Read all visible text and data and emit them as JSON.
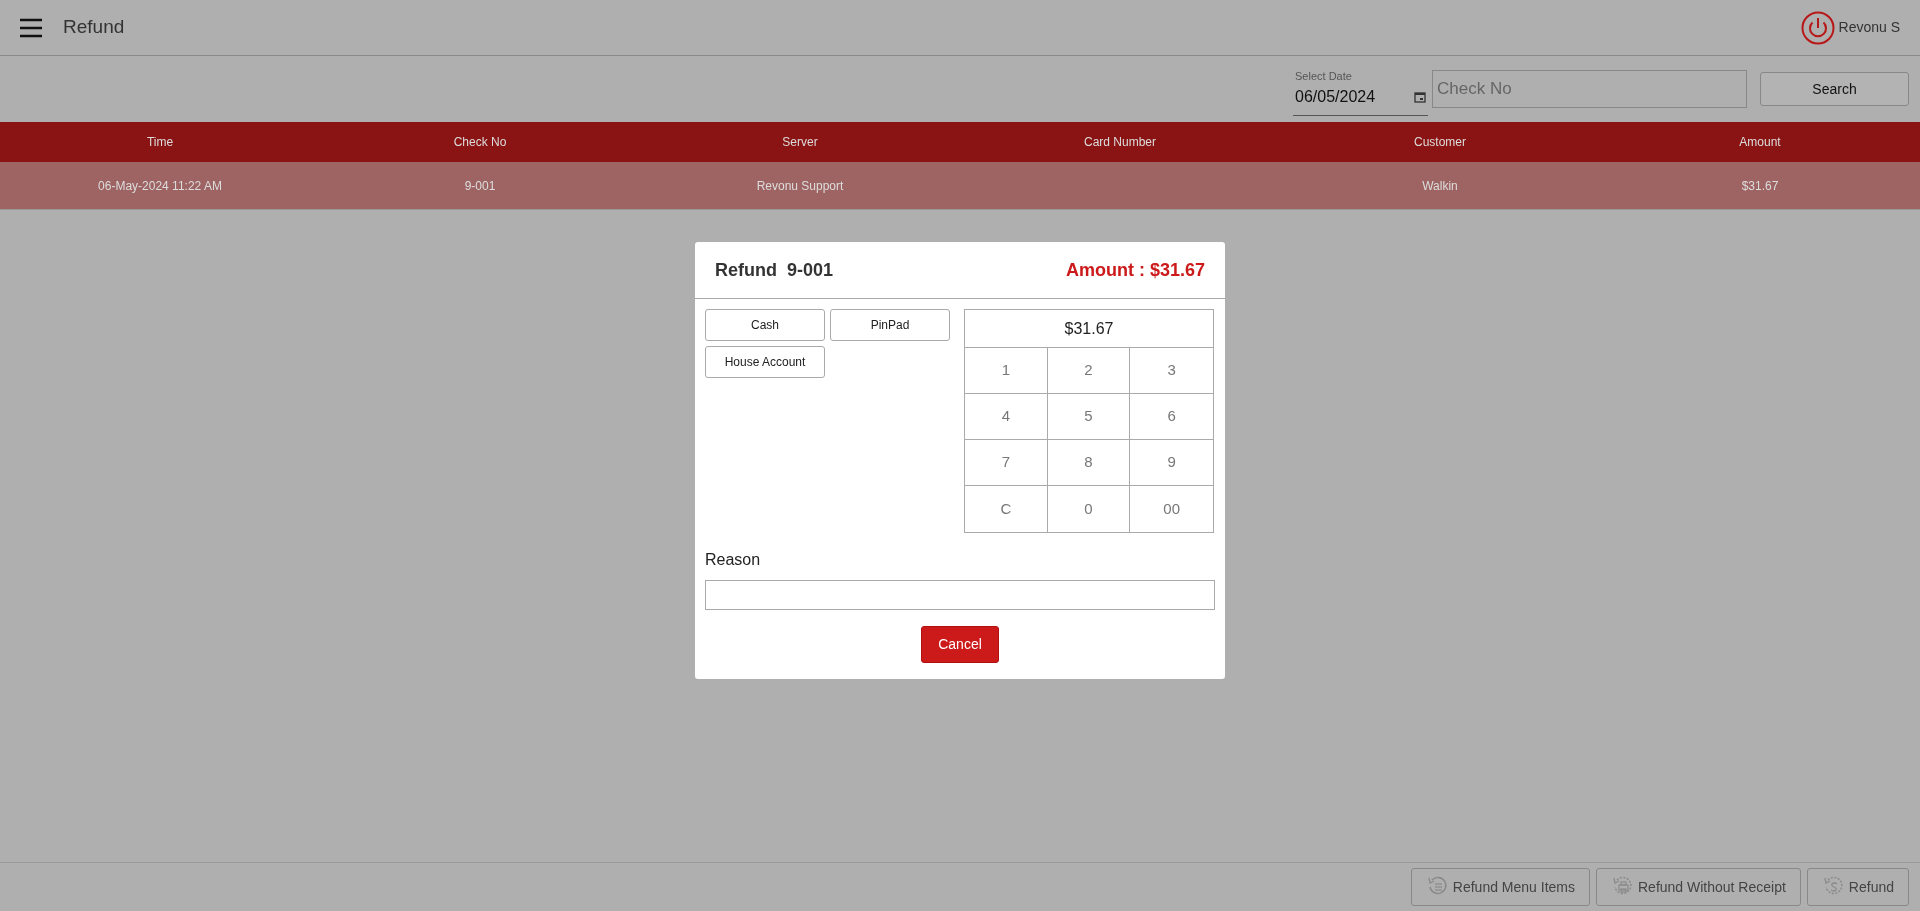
{
  "app_bar": {
    "title": "Refund",
    "user": "Revonu S"
  },
  "filters": {
    "date_label": "Select Date",
    "date_value": "06/05/2024",
    "check_placeholder": "Check No",
    "search_button": "Search"
  },
  "table": {
    "columns": [
      "Time",
      "Check No",
      "Server",
      "Card Number",
      "Customer",
      "Amount"
    ],
    "rows": [
      {
        "selected": true,
        "cells": [
          "06-May-2024 11:22 AM",
          "9-001",
          "Revonu Support",
          "",
          "Walkin",
          "$31.67"
        ]
      }
    ]
  },
  "dialog": {
    "title": "Refund  9-001",
    "amount": "Amount : $31.67",
    "payment_buttons": [
      "Cash",
      "PinPad",
      "House Account"
    ],
    "display": "$31.67",
    "keys": [
      "1",
      "2",
      "3",
      "4",
      "5",
      "6",
      "7",
      "8",
      "9",
      "C",
      "0",
      "00"
    ],
    "reason_label": "Reason",
    "cancel_button": "Cancel"
  },
  "footer_buttons": [
    {
      "kind": "menu",
      "label": "Refund Menu Items"
    },
    {
      "kind": "printer",
      "label": "Refund Without Receipt"
    },
    {
      "kind": "dollar",
      "label": "Refund"
    }
  ]
}
